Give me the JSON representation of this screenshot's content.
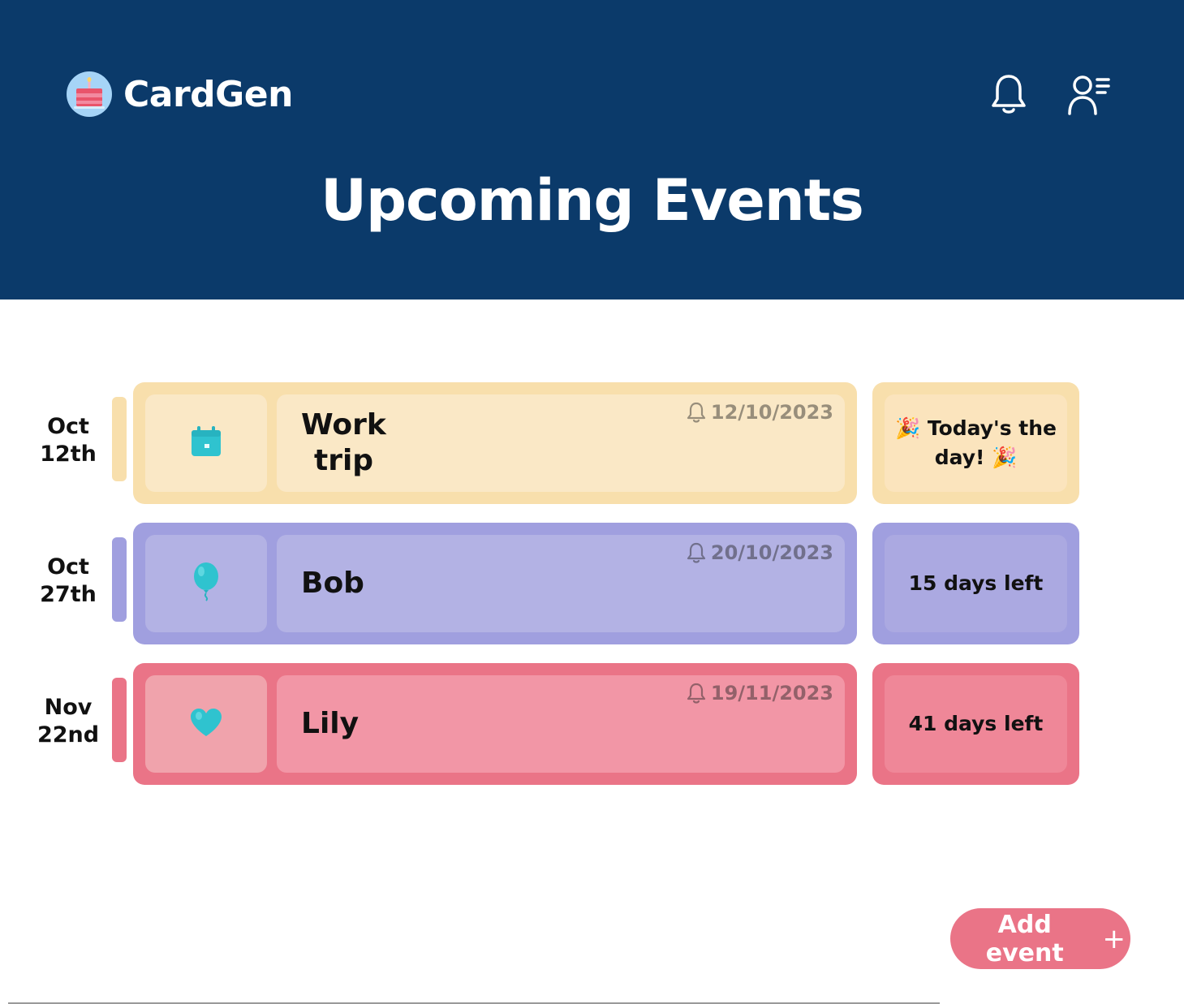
{
  "app": {
    "name": "CardGen",
    "title": "Upcoming Events"
  },
  "header": {
    "icons": [
      "bell-icon",
      "user-menu-icon"
    ]
  },
  "events": [
    {
      "date_month": "Oct",
      "date_day": "12th",
      "name_line1": "Work",
      "name_line2": "trip",
      "icon": "calendar-icon",
      "reminder_date": "12/10/2023",
      "countdown_prefix": "🎉",
      "countdown": "Today's the day!",
      "countdown_suffix": "🎉",
      "colors": {
        "card": "#f8dfac",
        "inner": "#fae8c6",
        "countdown_inner": "#fbe4bd",
        "stripe": "#f8dfac"
      }
    },
    {
      "date_month": "Oct",
      "date_day": "27th",
      "name_line1": "Bob",
      "icon": "balloon-icon",
      "reminder_date": "20/10/2023",
      "countdown": "15 days left",
      "colors": {
        "card": "#a09fdf",
        "inner": "#b3b2e4",
        "countdown_inner": "#aba9e1",
        "stripe": "#a09fdf"
      }
    },
    {
      "date_month": "Nov",
      "date_day": "22nd",
      "name_line1": "Lily",
      "icon": "heart-icon",
      "reminder_date": "19/11/2023",
      "countdown": "41 days left",
      "colors": {
        "card": "#ea7487",
        "inner": "#f296a6",
        "countdown_inner": "#ef8798",
        "stripe": "#ea7487"
      }
    }
  ],
  "actions": {
    "add_event_label": "Add event",
    "add_event_symbol": "+"
  },
  "colors": {
    "header_bg": "#0b3a6a",
    "accent": "#ea7487",
    "icon_teal": "#2fc3cf"
  }
}
